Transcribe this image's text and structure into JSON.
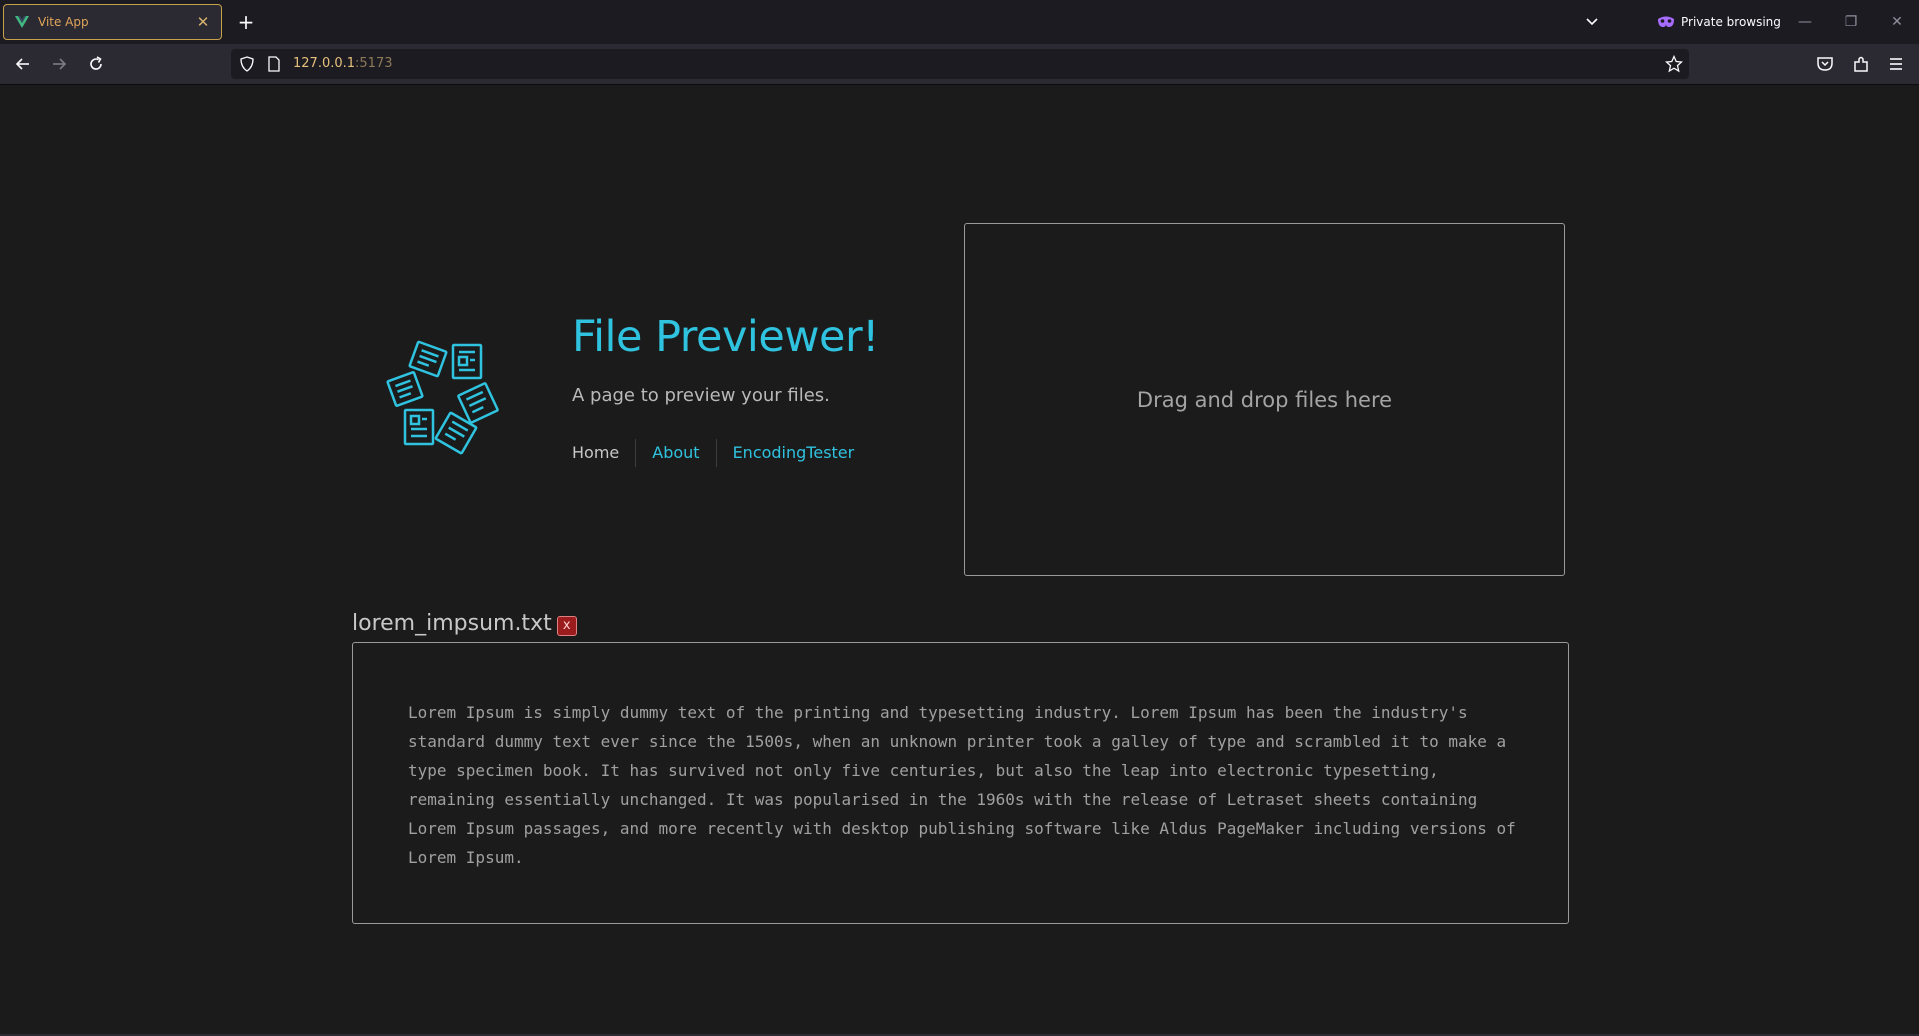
{
  "browser": {
    "tab_title": "Vite App",
    "tab_close": "✕",
    "new_tab": "+",
    "private_label": "Private browsing",
    "url_host": "127.0.0.1",
    "url_port": ":5173",
    "window_minimize": "—",
    "window_restore": "❐",
    "window_close": "✕"
  },
  "header": {
    "title": "File Previewer!",
    "subtitle": "A page to preview your files.",
    "nav": [
      "Home",
      "About",
      "EncodingTester"
    ]
  },
  "dropzone": {
    "label": "Drag and drop files here"
  },
  "file": {
    "name": "lorem_impsum.txt",
    "remove_label": "x",
    "content": "Lorem Ipsum is simply dummy text of the printing and typesetting industry. Lorem Ipsum has been the industry's standard dummy text ever since the 1500s, when an unknown printer took a galley of type and scrambled it to make a type specimen book. It has survived not only five centuries, but also the leap into electronic typesetting, remaining essentially unchanged. It was popularised in the 1960s with the release of Letraset sheets containing Lorem Ipsum passages, and more recently with desktop publishing software like Aldus PageMaker including versions of Lorem Ipsum."
  },
  "colors": {
    "accent": "#2fc3e0",
    "tab_accent": "#e0a458",
    "background": "#1b1b1b"
  }
}
